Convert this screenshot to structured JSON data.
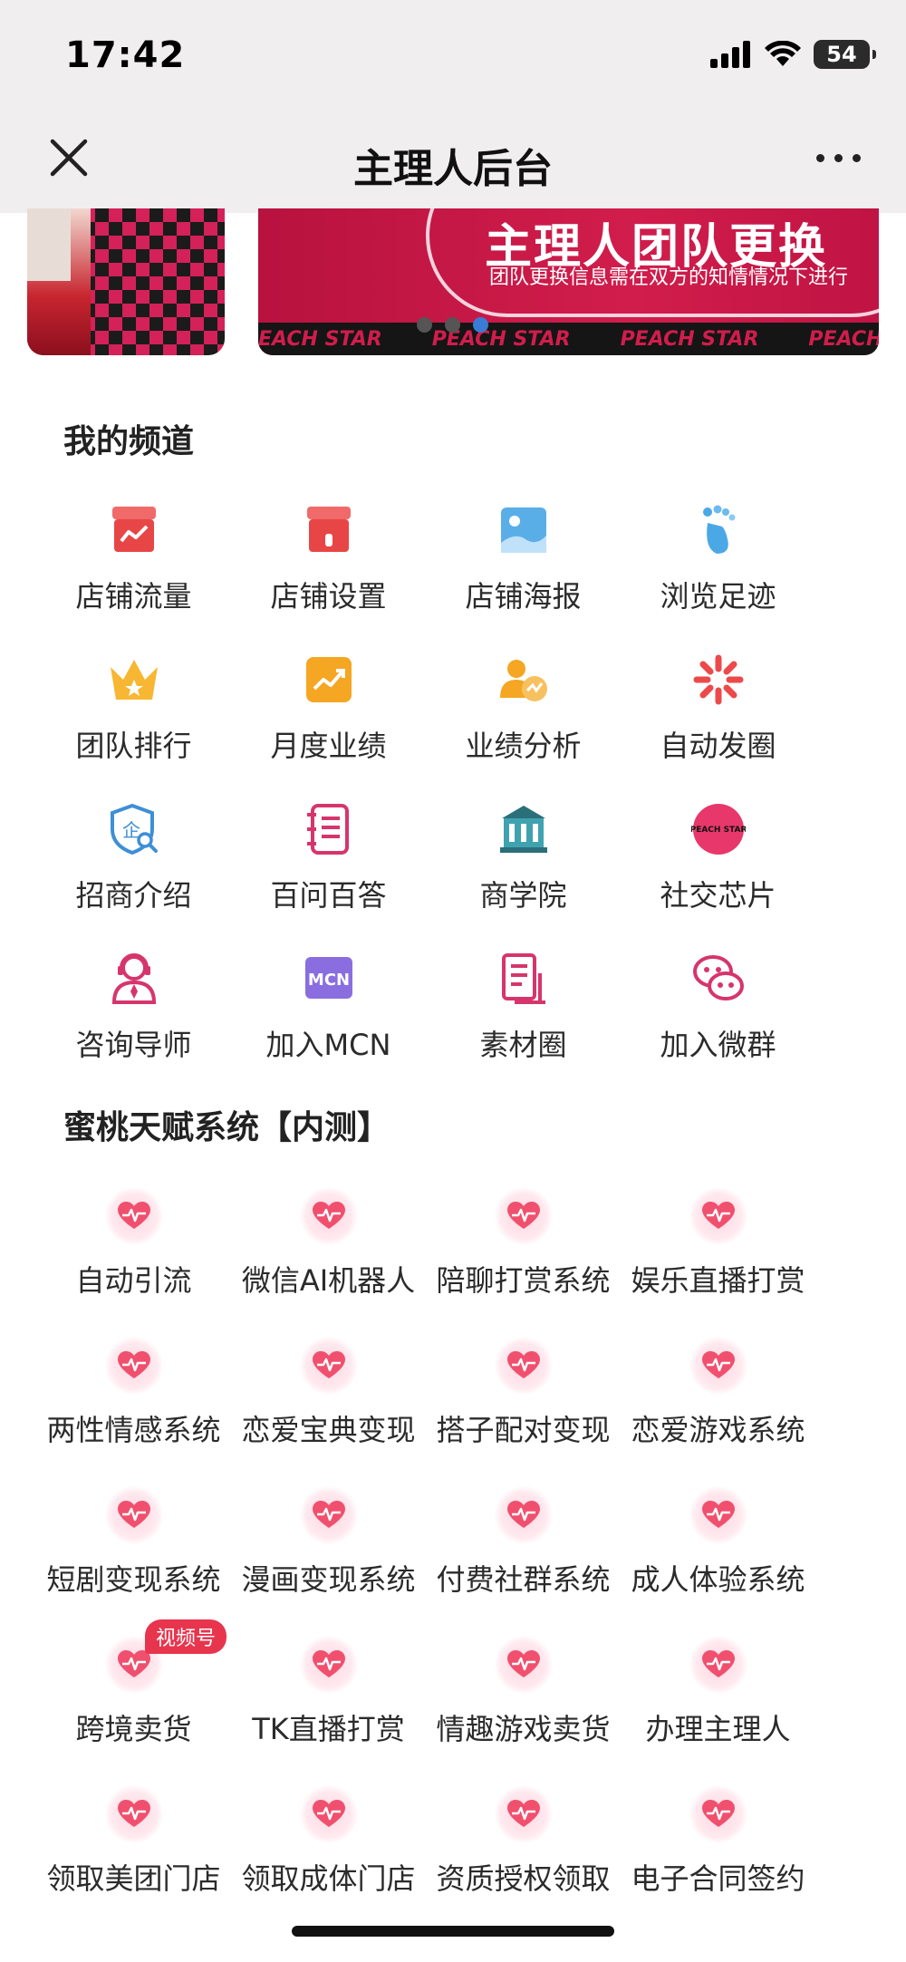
{
  "status_bar": {
    "time": "17:42",
    "battery": "54"
  },
  "navbar": {
    "title": "主理人后台"
  },
  "banner": {
    "title": "主理人团队更换",
    "subtitle": "团队更换信息需在双方的知情情况下进行",
    "strip": [
      "EACH STAR",
      "PEACH STAR",
      "PEACH STAR",
      "PEACH ST"
    ],
    "slides": 3,
    "active_slide": 3
  },
  "channels": {
    "title": "我的频道",
    "items": [
      {
        "label": "店铺流量",
        "icon": "shop-traffic-icon"
      },
      {
        "label": "店铺设置",
        "icon": "shop-settings-icon"
      },
      {
        "label": "店铺海报",
        "icon": "shop-poster-icon"
      },
      {
        "label": "浏览足迹",
        "icon": "footprint-icon"
      },
      {
        "label": "团队排行",
        "icon": "crown-icon"
      },
      {
        "label": "月度业绩",
        "icon": "trend-icon"
      },
      {
        "label": "业绩分析",
        "icon": "users-chart-icon"
      },
      {
        "label": "自动发圈",
        "icon": "burst-icon"
      },
      {
        "label": "招商介绍",
        "icon": "shield-search-icon"
      },
      {
        "label": "百问百答",
        "icon": "notebook-icon"
      },
      {
        "label": "商学院",
        "icon": "school-icon"
      },
      {
        "label": "社交芯片",
        "icon": "peach-star-chip-icon"
      },
      {
        "label": "咨询导师",
        "icon": "mentor-icon"
      },
      {
        "label": "加入MCN",
        "icon": "mcn-icon"
      },
      {
        "label": "素材圈",
        "icon": "material-icon"
      },
      {
        "label": "加入微群",
        "icon": "wechat-group-icon"
      }
    ],
    "mcn_icon_text": "MCN",
    "chip_text": "PEACH STAR"
  },
  "talent": {
    "title": "蜜桃天赋系统【内测】",
    "badge": "视频号",
    "items": [
      "自动引流",
      "微信AI机器人",
      "陪聊打赏系统",
      "娱乐直播打赏",
      "两性情感系统",
      "恋爱宝典变现",
      "搭子配对变现",
      "恋爱游戏系统",
      "短剧变现系统",
      "漫画变现系统",
      "付费社群系统",
      "成人体验系统",
      "跨境卖货",
      "TK直播打赏",
      "情趣游戏卖货",
      "办理主理人",
      "领取美团门店",
      "领取成体门店",
      "资质授权领取",
      "电子合同签约"
    ]
  },
  "colors": {
    "brand_red": "#e8354e",
    "heart": "#f0506e",
    "active_dot": "#3a7bd5"
  }
}
